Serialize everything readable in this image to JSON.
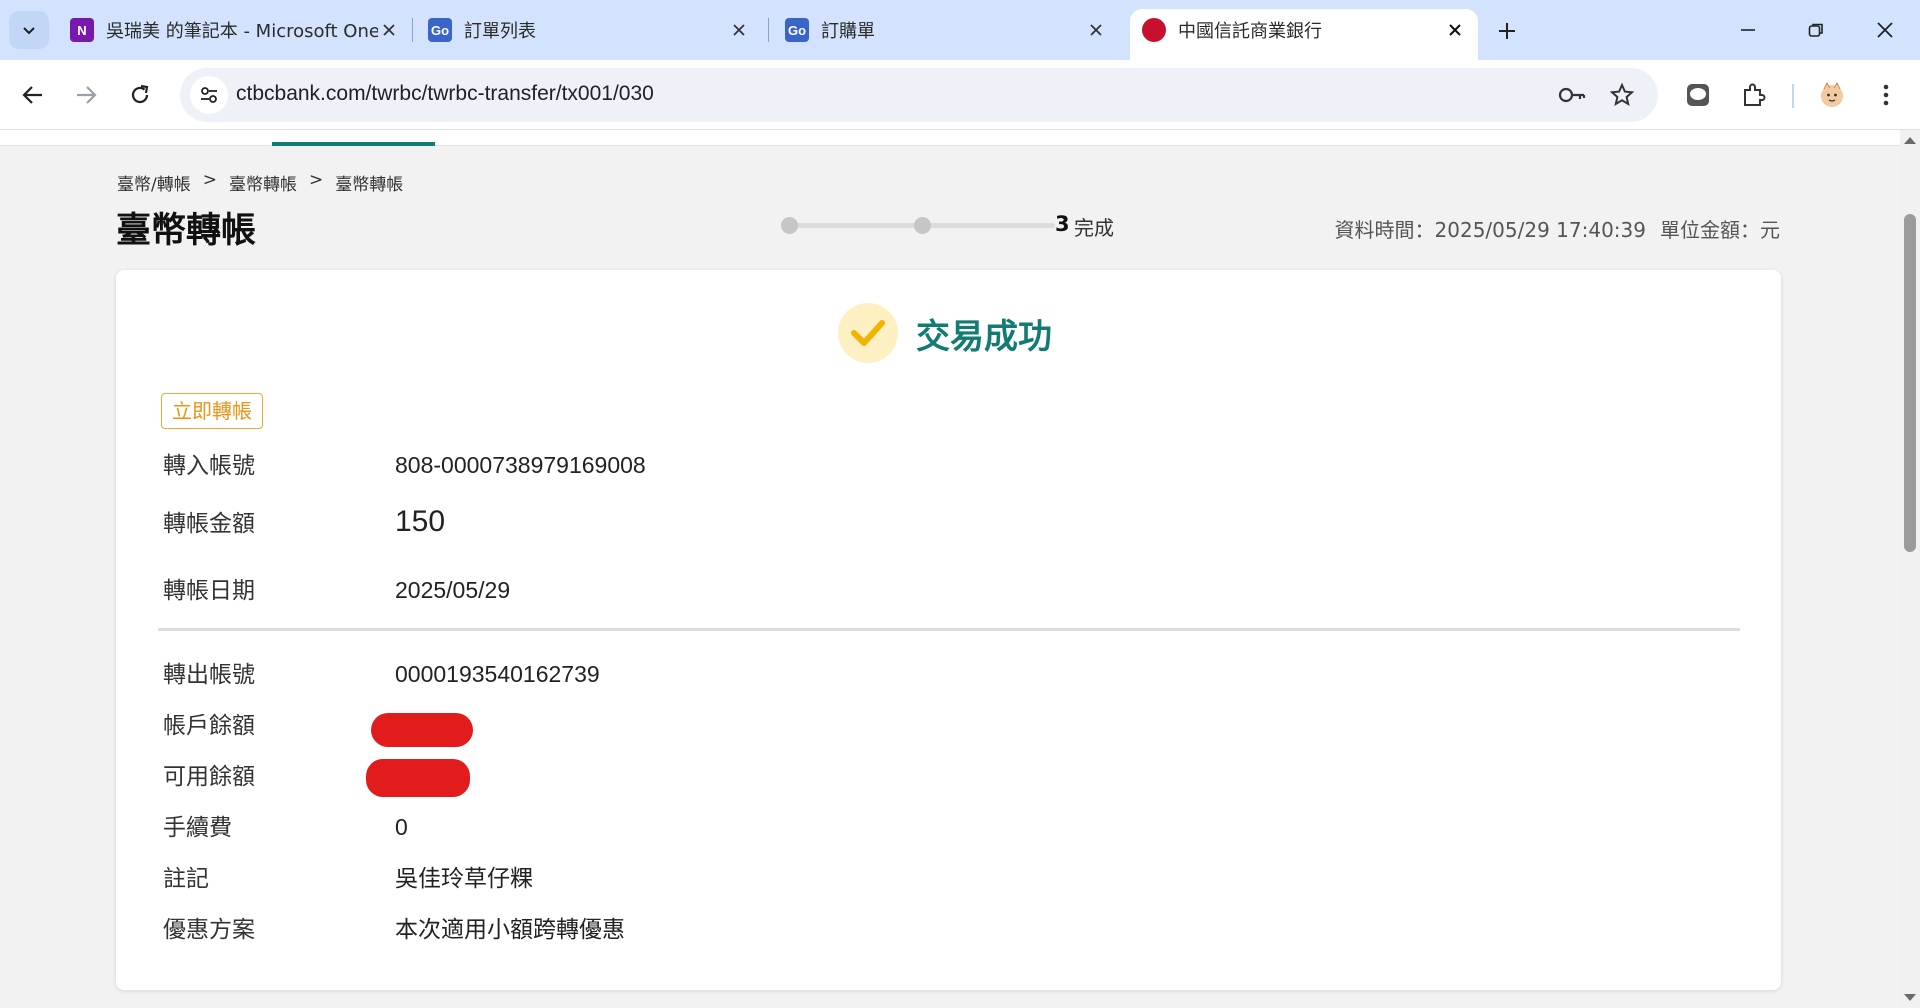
{
  "browser": {
    "tabs": [
      {
        "title": "吳瑞美 的筆記本 - Microsoft OneNote",
        "favicon": "onenote-icon",
        "active": false
      },
      {
        "title": "訂單列表",
        "favicon": "go-icon",
        "active": false
      },
      {
        "title": "訂購單",
        "favicon": "go-icon",
        "active": false
      },
      {
        "title": "中國信託商業銀行",
        "favicon": "ctbc-icon",
        "active": true
      }
    ],
    "url": "ctbcbank.com/twrbc/twrbc-transfer/tx001/030"
  },
  "page": {
    "breadcrumb": [
      "臺幣/轉帳",
      "臺幣轉帳",
      "臺幣轉帳"
    ],
    "breadcrumb_sep": ">",
    "title": "臺幣轉帳",
    "stepper": {
      "current_step": "3",
      "current_label": "完成",
      "total_steps": 3
    },
    "meta": {
      "data_time": "資料時間：2025/05/29 17:40:39",
      "unit": "單位金額：元"
    },
    "result": {
      "text": "交易成功",
      "status_color": "#127b73"
    },
    "transfer_tag": "立即轉帳",
    "fields_top": [
      {
        "label": "轉入帳號",
        "value": "808-0000738979169008"
      },
      {
        "label": "轉帳金額",
        "value": "150"
      },
      {
        "label": "轉帳日期",
        "value": "2025/05/29"
      }
    ],
    "fields_bottom": [
      {
        "label": "轉出帳號",
        "value": "0000193540162739"
      },
      {
        "label": "帳戶餘額",
        "value": ""
      },
      {
        "label": "可用餘額",
        "value": ""
      },
      {
        "label": "手續費",
        "value": "0"
      },
      {
        "label": "註記",
        "value": "吳佳玲草仔粿"
      },
      {
        "label": "優惠方案",
        "value": "本次適用小額跨轉優惠"
      }
    ]
  },
  "colors": {
    "accent": "#127b73",
    "tag": "#e8951a",
    "redaction": "#e21c1c"
  }
}
